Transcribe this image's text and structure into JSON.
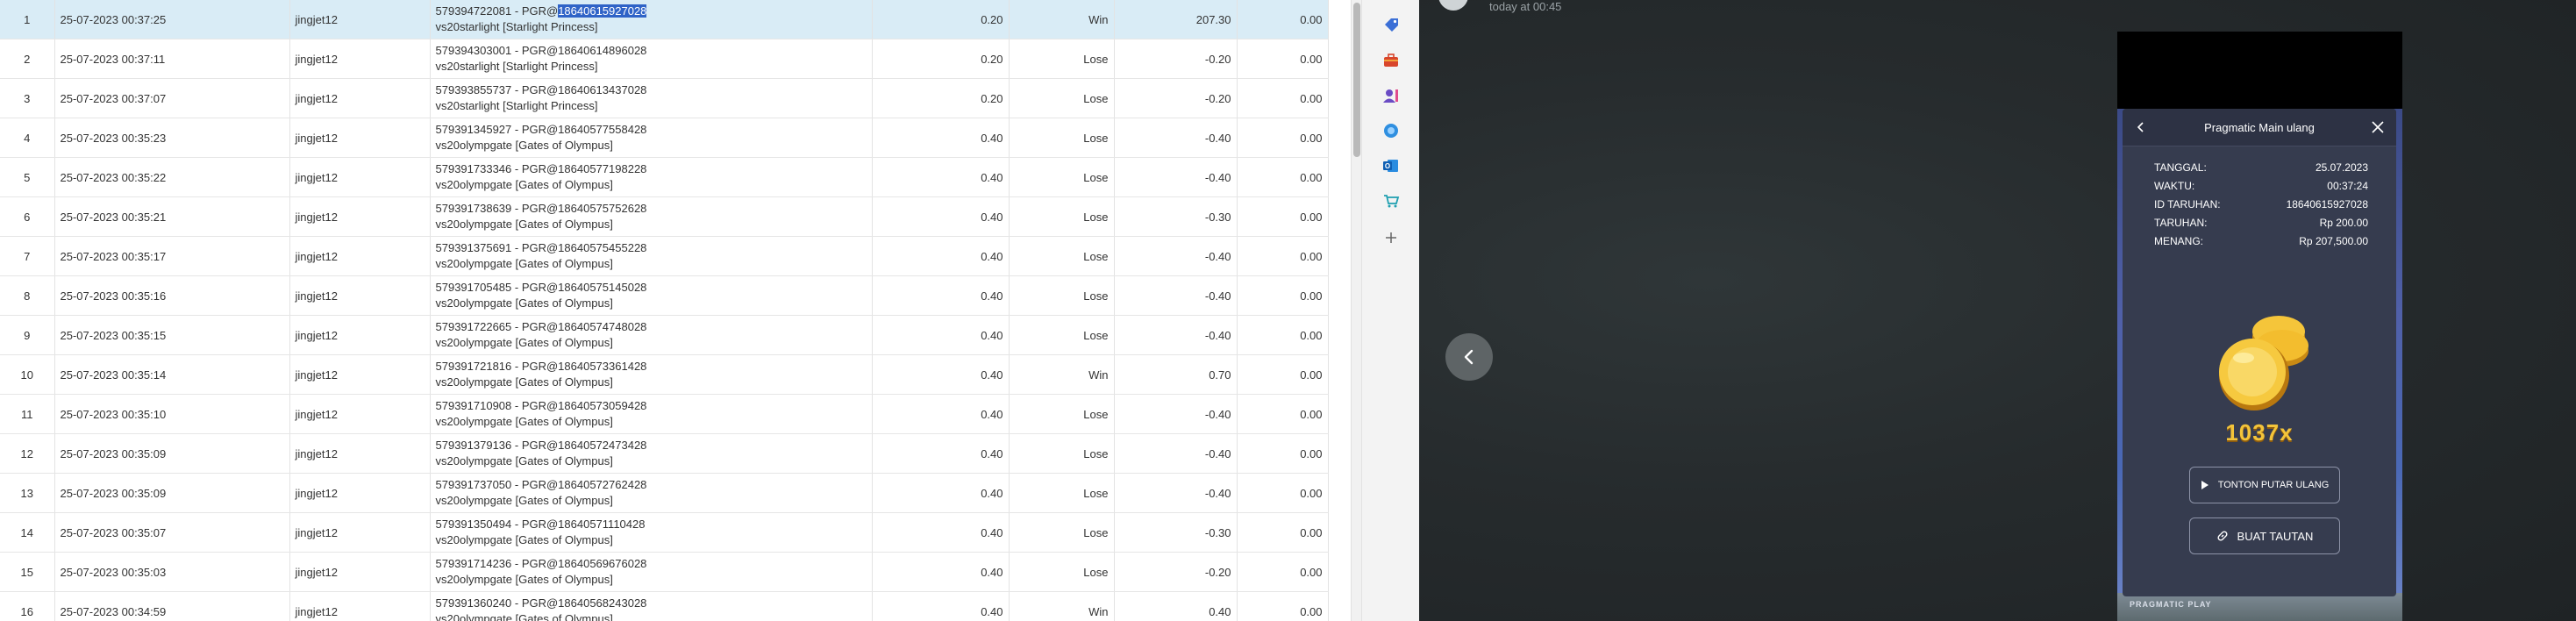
{
  "history": {
    "rows": [
      {
        "no": "1",
        "datetime": "25-07-2023 00:37:25",
        "user": "jingjet12",
        "id_prefix": "579394722081 - PGR@",
        "id_hl": "18640615927028",
        "game": "vs20starlight [Starlight Princess]",
        "stake": "0.20",
        "result": "Win",
        "payout": "207.30",
        "extra": "0.00",
        "selected": true
      },
      {
        "no": "2",
        "datetime": "25-07-2023 00:37:11",
        "user": "jingjet12",
        "id_prefix": "579394303001 - PGR@18640614896028",
        "id_hl": "",
        "game": "vs20starlight [Starlight Princess]",
        "stake": "0.20",
        "result": "Lose",
        "payout": "-0.20",
        "extra": "0.00"
      },
      {
        "no": "3",
        "datetime": "25-07-2023 00:37:07",
        "user": "jingjet12",
        "id_prefix": "579393855737 - PGR@18640613437028",
        "id_hl": "",
        "game": "vs20starlight [Starlight Princess]",
        "stake": "0.20",
        "result": "Lose",
        "payout": "-0.20",
        "extra": "0.00"
      },
      {
        "no": "4",
        "datetime": "25-07-2023 00:35:23",
        "user": "jingjet12",
        "id_prefix": "579391345927 - PGR@18640577558428",
        "id_hl": "",
        "game": "vs20olympgate [Gates of Olympus]",
        "stake": "0.40",
        "result": "Lose",
        "payout": "-0.40",
        "extra": "0.00"
      },
      {
        "no": "5",
        "datetime": "25-07-2023 00:35:22",
        "user": "jingjet12",
        "id_prefix": "579391733346 - PGR@18640577198228",
        "id_hl": "",
        "game": "vs20olympgate [Gates of Olympus]",
        "stake": "0.40",
        "result": "Lose",
        "payout": "-0.40",
        "extra": "0.00"
      },
      {
        "no": "6",
        "datetime": "25-07-2023 00:35:21",
        "user": "jingjet12",
        "id_prefix": "579391738639 - PGR@18640575752628",
        "id_hl": "",
        "game": "vs20olympgate [Gates of Olympus]",
        "stake": "0.40",
        "result": "Lose",
        "payout": "-0.30",
        "extra": "0.00"
      },
      {
        "no": "7",
        "datetime": "25-07-2023 00:35:17",
        "user": "jingjet12",
        "id_prefix": "579391375691 - PGR@18640575455228",
        "id_hl": "",
        "game": "vs20olympgate [Gates of Olympus]",
        "stake": "0.40",
        "result": "Lose",
        "payout": "-0.40",
        "extra": "0.00"
      },
      {
        "no": "8",
        "datetime": "25-07-2023 00:35:16",
        "user": "jingjet12",
        "id_prefix": "579391705485 - PGR@18640575145028",
        "id_hl": "",
        "game": "vs20olympgate [Gates of Olympus]",
        "stake": "0.40",
        "result": "Lose",
        "payout": "-0.40",
        "extra": "0.00"
      },
      {
        "no": "9",
        "datetime": "25-07-2023 00:35:15",
        "user": "jingjet12",
        "id_prefix": "579391722665 - PGR@18640574748028",
        "id_hl": "",
        "game": "vs20olympgate [Gates of Olympus]",
        "stake": "0.40",
        "result": "Lose",
        "payout": "-0.40",
        "extra": "0.00"
      },
      {
        "no": "10",
        "datetime": "25-07-2023 00:35:14",
        "user": "jingjet12",
        "id_prefix": "579391721816 - PGR@18640573361428",
        "id_hl": "",
        "game": "vs20olympgate [Gates of Olympus]",
        "stake": "0.40",
        "result": "Win",
        "payout": "0.70",
        "extra": "0.00"
      },
      {
        "no": "11",
        "datetime": "25-07-2023 00:35:10",
        "user": "jingjet12",
        "id_prefix": "579391710908 - PGR@18640573059428",
        "id_hl": "",
        "game": "vs20olympgate [Gates of Olympus]",
        "stake": "0.40",
        "result": "Lose",
        "payout": "-0.40",
        "extra": "0.00"
      },
      {
        "no": "12",
        "datetime": "25-07-2023 00:35:09",
        "user": "jingjet12",
        "id_prefix": "579391379136 - PGR@18640572473428",
        "id_hl": "",
        "game": "vs20olympgate [Gates of Olympus]",
        "stake": "0.40",
        "result": "Lose",
        "payout": "-0.40",
        "extra": "0.00"
      },
      {
        "no": "13",
        "datetime": "25-07-2023 00:35:09",
        "user": "jingjet12",
        "id_prefix": "579391737050 - PGR@18640572762428",
        "id_hl": "",
        "game": "vs20olympgate [Gates of Olympus]",
        "stake": "0.40",
        "result": "Lose",
        "payout": "-0.40",
        "extra": "0.00"
      },
      {
        "no": "14",
        "datetime": "25-07-2023 00:35:07",
        "user": "jingjet12",
        "id_prefix": "579391350494 - PGR@18640571110428",
        "id_hl": "",
        "game": "vs20olympgate [Gates of Olympus]",
        "stake": "0.40",
        "result": "Lose",
        "payout": "-0.30",
        "extra": "0.00"
      },
      {
        "no": "15",
        "datetime": "25-07-2023 00:35:03",
        "user": "jingjet12",
        "id_prefix": "579391714236 - PGR@18640569676028",
        "id_hl": "",
        "game": "vs20olympgate [Gates of Olympus]",
        "stake": "0.40",
        "result": "Lose",
        "payout": "-0.20",
        "extra": "0.00"
      },
      {
        "no": "16",
        "datetime": "25-07-2023 00:34:59",
        "user": "jingjet12",
        "id_prefix": "579391360240 - PGR@18640568243028",
        "id_hl": "",
        "game": "vs20olympgate [Gates of Olympus]",
        "stake": "0.40",
        "result": "Win",
        "payout": "0.40",
        "extra": "0.00"
      }
    ]
  },
  "sidebar": {
    "icons": [
      "tag-icon",
      "toolbox-icon",
      "contacts-icon",
      "copilot-icon",
      "outlook-icon",
      "shopping-cart-icon",
      "add-icon"
    ]
  },
  "chat": {
    "timestamp": "today at 00:45"
  },
  "game_panel": {
    "title": "Pragmatic Main ulang",
    "rows": [
      {
        "label": "TANGGAL:",
        "value": "25.07.2023"
      },
      {
        "label": "WAKTU:",
        "value": "00:37:24"
      },
      {
        "label": "ID TARUHAN:",
        "value": "18640615927028"
      },
      {
        "label": "TARUHAN:",
        "value": "Rp 200.00"
      },
      {
        "label": "MENANG:",
        "value": "Rp 207,500.00"
      }
    ],
    "multiplier": "1037x",
    "replay_button": "TONTON PUTAR ULANG",
    "link_button": "BUAT TAUTAN",
    "brand": "PRAGMATIC PLAY"
  },
  "colors": {
    "win": "#1e9e3a",
    "lose": "#e02424",
    "selected_row": "#d9ecf6",
    "highlight": "#2f63c7",
    "coin_gold": "#f3c43a"
  }
}
